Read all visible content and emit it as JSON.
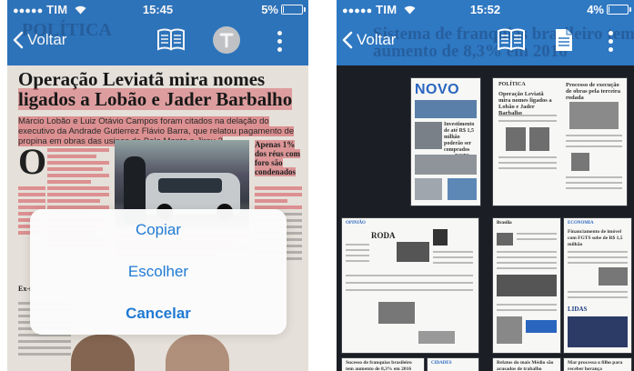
{
  "left": {
    "status": {
      "carrier": "TIM",
      "time": "15:45",
      "battery": "5%",
      "battery_level": 0.05
    },
    "nav": {
      "back_label": "Voltar",
      "ghost_section": "POLÍTICA"
    },
    "article": {
      "headline_line1": "Operação Leviatã mira nomes",
      "headline_line2_prefix": "ligados a Lobão e Jader Barbalho",
      "lede": "Márcio Lobão e Luiz Otávio Campos foram citados na delação do executivo da Andrade Gutierrez Flávio Barra, que relatou pagamento de propina em obras das usinas de Belo Monte e Jirau 2",
      "dropcap": "O",
      "side_head": "Apenas 1% dos réus com foro são condenados",
      "section_mark": "Ex-s"
    },
    "sheet": {
      "copy": "Copiar",
      "choose": "Escolher",
      "cancel": "Cancelar"
    }
  },
  "right": {
    "status": {
      "carrier": "TIM",
      "time": "15:52",
      "battery": "4%",
      "battery_level": 0.04
    },
    "nav": {
      "back_label": "Voltar",
      "ghost_title": "Sistema de franquias brasileiro tem aumento de 8,3% em 2016"
    },
    "thumbs": {
      "t1_masthead": "NOVO",
      "t1_story": "Investimento de até R$ 1,5 milhão poderão ser comprados com FGTS",
      "t2_section": "POLÍTICA",
      "t2_head": "Operação Leviatã mira nomes ligados a Lobão e Jader Barbalho",
      "t2_side": "Processo de execução de obras pela terceira rodada",
      "t3_section": "OPINIÃO",
      "t3_logo": "RODA",
      "t4_section": "Brasília",
      "t5_section": "ECONOMIA",
      "t5_head": "Financiamento de imóvel com FGTS sobe de R$ 1,5 milhão",
      "t5_brand": "LIDAS",
      "t6_caption": "Sucesso de franquias brasileiro tem aumento de 8,3% em 2016",
      "t7_section": "CIDADES",
      "t8_caption": "Relatos do mais Médio são acusados de trabalho",
      "t9_caption": "Mar processa o filho para receber herança"
    }
  },
  "colors": {
    "nav_blue": "#2f78c2",
    "highlight_red": "#dc505a",
    "ios_blue": "#1f7ad4"
  }
}
